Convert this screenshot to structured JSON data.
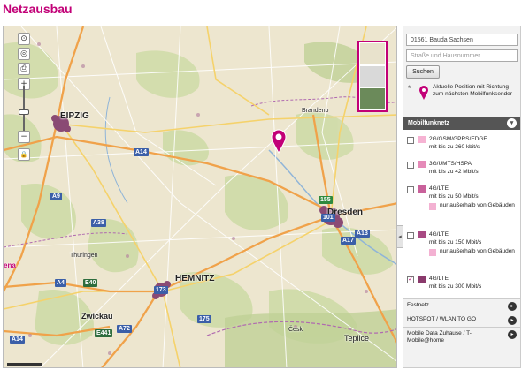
{
  "page": {
    "title": "Netzausbau"
  },
  "map": {
    "cities": [
      "Leipzig",
      "Dresden",
      "Chemnitz",
      "Zwickau",
      "Teplice",
      "Thüringen"
    ],
    "partial_labels": {
      "leipzig": "EIPZIG",
      "chemnitz": "HEMNITZ",
      "thueringen": "Thüringen",
      "brandenburg": "Brandenb",
      "ceske": "Česk",
      "left_edge": "ena"
    },
    "roads": [
      "A14",
      "A38",
      "A9",
      "A13",
      "A4",
      "E40",
      "A72",
      "A17",
      "E441",
      "A14",
      "155",
      "173",
      "101",
      "175"
    ],
    "controls": {
      "pan": "⊙",
      "location": "◎",
      "print": "⎙",
      "zoom_in": "+",
      "zoom_out": "−",
      "lock": "🔒",
      "collapse": "◂"
    }
  },
  "sidebar": {
    "location_input_value": "01561 Bauda Sachsen",
    "street_input_placeholder": "Straße und Hausnummer",
    "search_label": "Suchen",
    "position_text": "Aktuelle Position mit Richtung zum nächsten Mobilfunksender",
    "mobilfunknetz": {
      "label": "Mobilfunknetz",
      "items": [
        {
          "name": "2G/GSM/GPRS/EDGE",
          "speed": "mit bis zu 260 kbit/s",
          "color": "#f6b3d3",
          "checked": false
        },
        {
          "name": "3G/UMTS/HSPA",
          "speed": "mit bis zu 42 Mbit/s",
          "color": "#e58ab8",
          "checked": false
        },
        {
          "name": "4G/LTE",
          "speed": "mit bis zu 50 Mbit/s",
          "color": "#c9619b",
          "checked": false,
          "sub": "nur außerhalb von Gebäuden",
          "sub_color": "#f3b1d2"
        },
        {
          "name": "4G/LTE",
          "speed": "mit bis zu 150 Mbit/s",
          "color": "#a84a83",
          "checked": false,
          "sub": "nur außerhalb von Gebäuden",
          "sub_color": "#f3b1d2"
        },
        {
          "name": "4G/LTE",
          "speed": "mit bis zu 300 Mbit/s",
          "color": "#8a3a6c",
          "checked": true
        }
      ]
    },
    "links": {
      "festnetz": "Festnetz",
      "hotspot": "HOTSPOT / WLAN TO GO",
      "mobile_data": "Mobile Data Zuhause / T-Mobile@home"
    }
  },
  "colors": {
    "brand": "#c20077",
    "section_bg": "#555555"
  }
}
